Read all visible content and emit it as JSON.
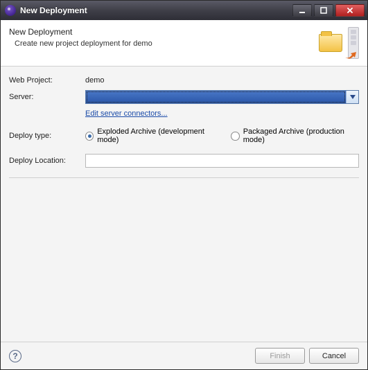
{
  "window": {
    "title": "New Deployment"
  },
  "header": {
    "title": "New Deployment",
    "subtitle": "Create new project deployment for demo"
  },
  "form": {
    "web_project_label": "Web Project:",
    "web_project_value": "demo",
    "server_label": "Server:",
    "server_value": "",
    "edit_connectors_link": "Edit server connectors...",
    "deploy_type_label": "Deploy type:",
    "deploy_type_options": {
      "exploded": "Exploded Archive (development mode)",
      "packaged": "Packaged Archive (production mode)"
    },
    "deploy_location_label": "Deploy Location:",
    "deploy_location_value": ""
  },
  "footer": {
    "help_tooltip": "?",
    "finish_label": "Finish",
    "cancel_label": "Cancel"
  }
}
